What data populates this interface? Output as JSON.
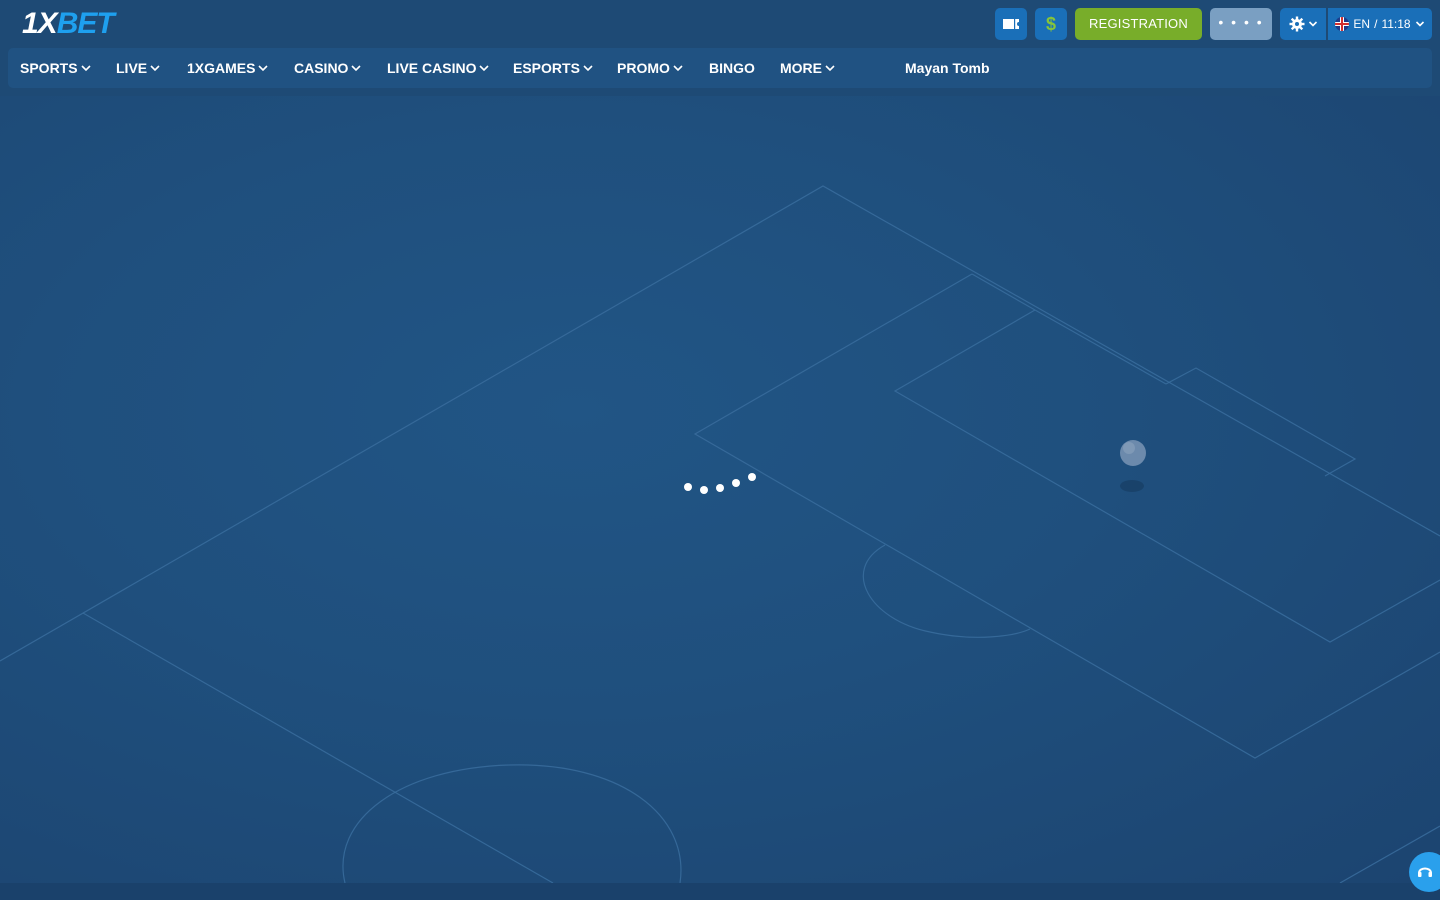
{
  "header": {
    "logo": {
      "part1": "1X",
      "part2": "BET"
    },
    "coupon_icon": "coupon-icon",
    "currency_icon": "dollar-icon",
    "currency_symbol": "$",
    "registration_label": "REGISTRATION",
    "login_label": "• • • •",
    "settings_icon": "gear-icon",
    "language_label": "EN",
    "time": "11:18",
    "colors": {
      "registration": "#78ad2a",
      "accent": "#1a6fb8",
      "logo_blue": "#1ea0ef"
    }
  },
  "nav": {
    "items": [
      {
        "label": "SPORTS",
        "dropdown": true
      },
      {
        "label": "LIVE",
        "dropdown": true
      },
      {
        "label": "1XGAMES",
        "dropdown": true
      },
      {
        "label": "CASINO",
        "dropdown": true
      },
      {
        "label": "LIVE CASINO",
        "dropdown": true
      },
      {
        "label": "ESPORTS",
        "dropdown": true
      },
      {
        "label": "PROMO",
        "dropdown": true
      },
      {
        "label": "BINGO",
        "dropdown": false
      },
      {
        "label": "MORE",
        "dropdown": true
      }
    ],
    "game_title": "Mayan Tomb"
  },
  "main": {
    "state": "loading",
    "loader_icon": "loading-dots-icon",
    "background_icon": "football-pitch-illustration"
  },
  "support": {
    "icon": "headset-icon"
  }
}
